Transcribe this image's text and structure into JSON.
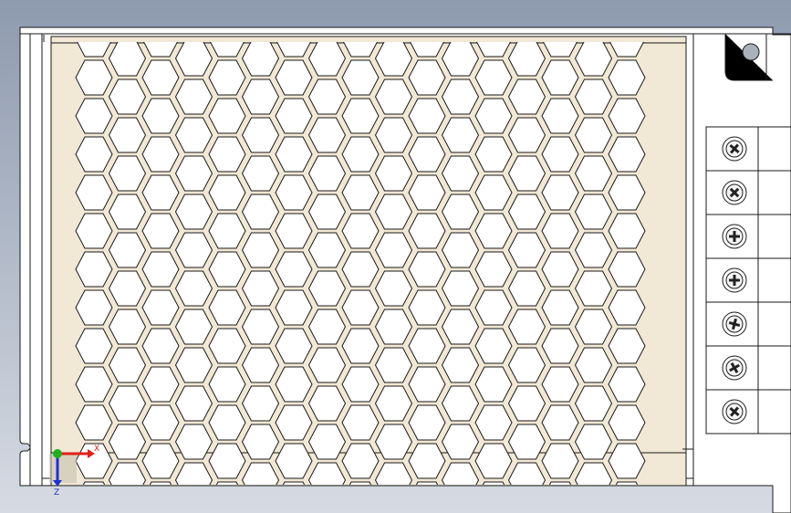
{
  "viewport": {
    "background_top": "#8e9aae",
    "background_bottom": "#d6dbe3"
  },
  "part": {
    "name": "power-supply-housing",
    "housing_color": "#ffffff",
    "edge_color": "#1a1a1a",
    "cover_fill": "#f1e8d5",
    "vent_hole_fill": "#ffffff",
    "vent_shape": "hexagon",
    "terminal_count": 7,
    "terminal_screw_icons": [
      "screw-head-icon",
      "screw-head-icon",
      "screw-head-icon",
      "screw-head-icon",
      "screw-head-icon",
      "screw-head-icon",
      "screw-head-icon"
    ],
    "mount_hole_fill": "#aab0bc"
  },
  "triad": {
    "x_label": "X",
    "z_label": "Z",
    "x_color": "#e0201a",
    "y_color": "#20b020",
    "z_color": "#2030d0"
  }
}
